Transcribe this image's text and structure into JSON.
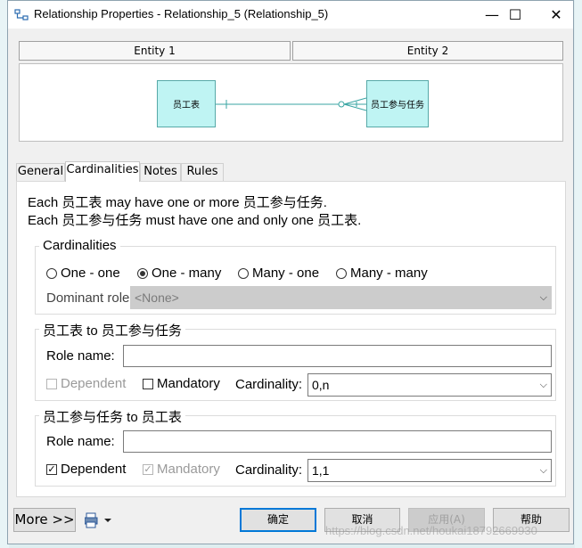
{
  "window": {
    "title": "Relationship Properties - Relationship_5 (Relationship_5)",
    "minimize_glyph": "—",
    "maximize_glyph": "☐",
    "close_glyph": "✕"
  },
  "entities": {
    "entity1_header": "Entity 1",
    "entity2_header": "Entity 2",
    "entity1_name": "员工表",
    "entity2_name": "员工参与任务"
  },
  "tabs": [
    "General",
    "Cardinalities",
    "Notes",
    "Rules"
  ],
  "active_tab": "Cardinalities",
  "description": {
    "line1": "Each 员工表 may have one or more 员工参与任务.",
    "line2": "Each 员工参与任务 must have one and only one 员工表."
  },
  "cardinalities": {
    "group_title": "Cardinalities",
    "options": [
      "One - one",
      "One - many",
      "Many - one",
      "Many - many"
    ],
    "selected": "One - many",
    "dominant_role_label": "Dominant role:",
    "dominant_role_value": "<None>"
  },
  "role1": {
    "group_title": "员工表 to 员工参与任务",
    "role_name_label": "Role name:",
    "role_name_value": "",
    "dependent_label": "Dependent",
    "dependent_checked": false,
    "mandatory_label": "Mandatory",
    "mandatory_checked": false,
    "cardinality_label": "Cardinality:",
    "cardinality_value": "0,n"
  },
  "role2": {
    "group_title": "员工参与任务 to 员工表",
    "role_name_label": "Role name:",
    "role_name_value": "",
    "dependent_label": "Dependent",
    "dependent_checked": true,
    "mandatory_label": "Mandatory",
    "mandatory_checked": true,
    "cardinality_label": "Cardinality:",
    "cardinality_value": "1,1"
  },
  "footer": {
    "more_label": "More >>",
    "ok_label": "确定",
    "cancel_label": "取消",
    "apply_label": "应用(A)",
    "help_label": "帮助",
    "watermark": "https://blog.csdn.net/houkai18792669930"
  },
  "colors": {
    "entity_fill": "#bff4f3",
    "entity_border": "#57a9a8",
    "relation_line": "#3aa5a3",
    "focus_border": "#0078d7"
  }
}
